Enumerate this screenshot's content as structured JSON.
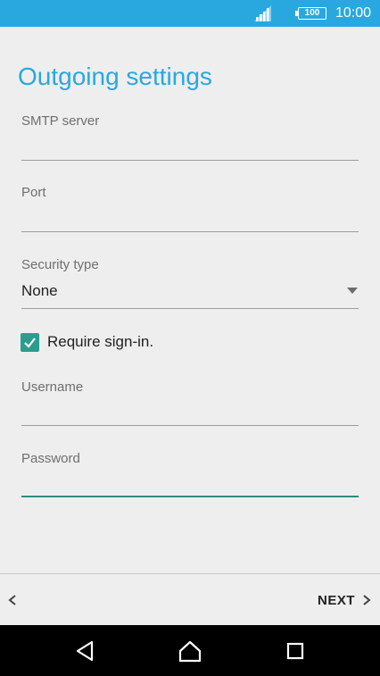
{
  "status_bar": {
    "battery": "100",
    "time": "10:00",
    "background": "#29a8e0"
  },
  "page": {
    "title": "Outgoing settings",
    "accent_color": "#29a8e0"
  },
  "fields": {
    "smtp_server": {
      "label": "SMTP server",
      "value": ""
    },
    "port": {
      "label": "Port",
      "value": ""
    },
    "security_type": {
      "label": "Security type",
      "value": "None"
    },
    "require_signin": {
      "label": "Require sign-in.",
      "checked": true
    },
    "username": {
      "label": "Username",
      "value": ""
    },
    "password": {
      "label": "Password",
      "value": ""
    }
  },
  "footer": {
    "next_label": "NEXT"
  },
  "icons": {
    "signal": "signal-icon",
    "back": "chevron-left-icon",
    "next": "chevron-right-icon",
    "nav_back": "triangle-back-icon",
    "nav_home": "home-icon",
    "nav_recents": "square-recents-icon"
  }
}
